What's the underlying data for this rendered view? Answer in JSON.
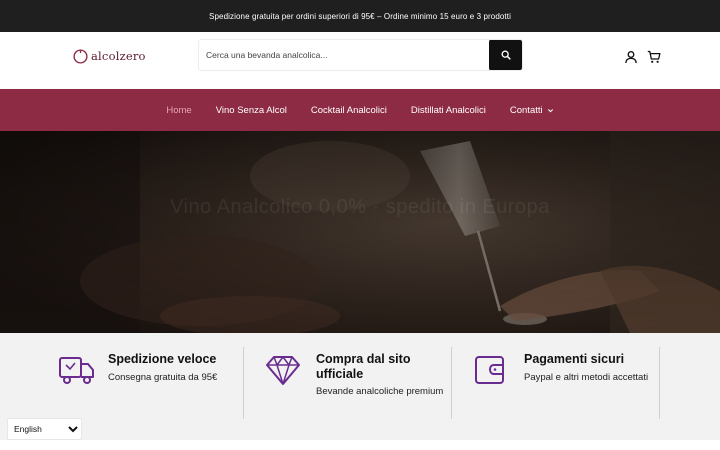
{
  "announcement": "Spedizione gratuita per ordini superiori di 95€  –  Ordine minimo 15 euro e 3 prodotti",
  "header": {
    "logo_text": "alcolzero",
    "search_placeholder": "Cerca una bevanda analcolica...",
    "icons": [
      "user-icon",
      "cart-icon",
      "search-icon"
    ]
  },
  "nav": {
    "items": [
      {
        "label": "Home",
        "active": true
      },
      {
        "label": "Vino Senza Alcol"
      },
      {
        "label": "Cocktail Analcolici"
      },
      {
        "label": "Distillati Analcolici"
      },
      {
        "label": "Contatti",
        "has_dropdown": true
      }
    ]
  },
  "hero": {
    "title": "Vino Analcolico 0,0% · spedito in Europa"
  },
  "features": [
    {
      "icon": "truck-icon",
      "title": "Spedizione veloce",
      "subtitle": "Consegna gratuita da 95€"
    },
    {
      "icon": "diamond-icon",
      "title": "Compra dal sito ufficiale",
      "subtitle": "Bevande analcoliche premium"
    },
    {
      "icon": "wallet-icon",
      "title": "Pagamenti sicuri",
      "subtitle": "Paypal e altri metodi accettati"
    }
  ],
  "language_selector": {
    "selected": "English"
  },
  "colors": {
    "announcement_bg": "#1f1f1f",
    "nav_bg": "#8c2b43",
    "nav_active": "#e9a3b4",
    "accent": "#6a2c8f",
    "features_bg": "#f2f2f2"
  }
}
